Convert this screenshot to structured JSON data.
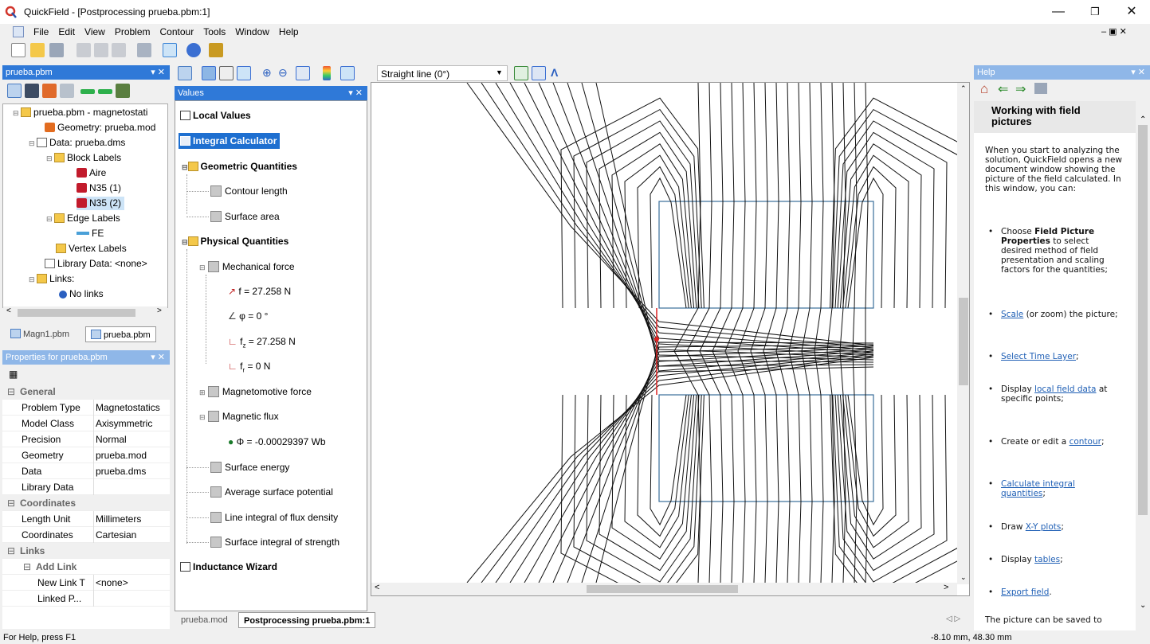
{
  "window": {
    "title": "QuickField - [Postprocessing prueba.pbm:1]"
  },
  "menu": [
    "File",
    "Edit",
    "View",
    "Problem",
    "Contour",
    "Tools",
    "Window",
    "Help"
  ],
  "problem_panel": {
    "title": "prueba.pbm",
    "tree": [
      {
        "label": "prueba.pbm - magnetostati",
        "icon": "folder-icon"
      },
      {
        "label": "Geometry: prueba.mod",
        "icon": "geometry-icon"
      },
      {
        "label": "Data: prueba.dms",
        "icon": "grid-icon"
      },
      {
        "label": "Block Labels",
        "icon": "folder-icon"
      },
      {
        "label": "Aire",
        "icon": "block-label-icon"
      },
      {
        "label": "N35 (1)",
        "icon": "block-label-icon"
      },
      {
        "label": "N35 (2)",
        "icon": "block-label-icon"
      },
      {
        "label": "Edge Labels",
        "icon": "folder-icon"
      },
      {
        "label": "FE",
        "icon": "edge-label-icon"
      },
      {
        "label": "Vertex Labels",
        "icon": "folder-icon"
      },
      {
        "label": "Library Data: <none>",
        "icon": "grid-icon"
      },
      {
        "label": "Links:",
        "icon": "folder-icon"
      },
      {
        "label": "No links",
        "icon": "link-icon"
      }
    ],
    "tabs": [
      "Magn1.pbm",
      "prueba.pbm"
    ]
  },
  "properties": {
    "title": "Properties for prueba.pbm",
    "rows": [
      {
        "k": "General",
        "v": "",
        "cat": true
      },
      {
        "k": "Problem Type",
        "v": "Magnetostatics"
      },
      {
        "k": "Model Class",
        "v": "Axisymmetric"
      },
      {
        "k": "Precision",
        "v": "Normal"
      },
      {
        "k": "Geometry",
        "v": "prueba.mod"
      },
      {
        "k": "Data",
        "v": "prueba.dms"
      },
      {
        "k": "Library Data",
        "v": ""
      },
      {
        "k": "Coordinates",
        "v": "",
        "cat": true
      },
      {
        "k": "Length Unit",
        "v": "Millimeters"
      },
      {
        "k": "Coordinates",
        "v": "Cartesian"
      },
      {
        "k": "Links",
        "v": "",
        "cat": true
      },
      {
        "k": "Add Link",
        "v": "",
        "sub": true
      },
      {
        "k": "New Link T",
        "v": "<none>",
        "sub2": true
      },
      {
        "k": "Linked P...",
        "v": "",
        "sub2": true
      }
    ]
  },
  "toolbar2": {
    "contour_select": "Straight line (0°)"
  },
  "values_panel": {
    "title": "Values",
    "local_values": "Local Values",
    "integral_calculator": "Integral Calculator",
    "geometric_quantities": "Geometric Quantities",
    "contour_length": "Contour length",
    "surface_area": "Surface area",
    "physical_quantities": "Physical Quantities",
    "mechanical_force": "Mechanical force",
    "f": "f = 27.258 N",
    "phi": "φ = 0 °",
    "fz_sym": "f",
    "fz_sub": "z",
    "fz_val": " = 27.258 N",
    "fr_sym": "f",
    "fr_sub": "r",
    "fr_val": " = 0 N",
    "magnetomotive_force": "Magnetomotive force",
    "magnetic_flux": "Magnetic flux",
    "flux_value": "Φ = -0.00029397 Wb",
    "surface_energy": "Surface energy",
    "avg_surface_potential": "Average surface potential",
    "line_integral": "Line integral of flux density",
    "surface_integral": "Surface integral of strength",
    "inductance_wizard": "Inductance  Wizard"
  },
  "doc_tabs": [
    "prueba.mod",
    "Postprocessing prueba.pbm:1"
  ],
  "help": {
    "title": "Help",
    "heading": "Working with field pictures",
    "intro": "When you start to analyzing the solution, QuickField opens a new document window showing the picture of the field calculated. In this window, you can:",
    "b1_pre": "Choose ",
    "b1_bold": "Field Picture Properties",
    "b1_post": " to select desired method of field presentation and scaling factors for the quantities;",
    "b2_link": "Scale",
    "b2_post": " (or zoom) the picture;",
    "b3_link": "Select Time Layer",
    "b3_post": ";",
    "b4_pre": "Display ",
    "b4_link": "local field data",
    "b4_post": " at specific points;",
    "b5_pre": "Create or edit a ",
    "b5_link": "contour",
    "b5_post": ";",
    "b6_link": "Calculate integral quantities",
    "b6_post": ";",
    "b7_pre": "Draw ",
    "b7_link": "X-Y plots",
    "b7_post": ";",
    "b8_pre": "Display ",
    "b8_link": "tables",
    "b8_post": ";",
    "b9_link": "Export field",
    "b9_post": ".",
    "footer": "The picture can be saved to"
  },
  "status": {
    "left": "For Help, press F1",
    "right": "-8.10 mm, 48.30 mm"
  }
}
